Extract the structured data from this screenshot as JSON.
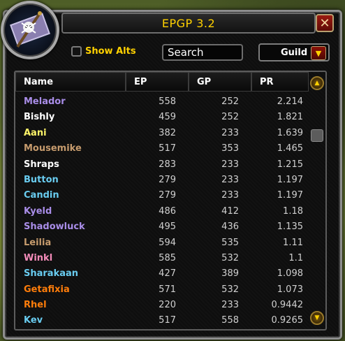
{
  "window": {
    "title": "EPGP 3.2",
    "close_glyph": "✕"
  },
  "toolbar": {
    "show_alts_label": "Show Alts",
    "search_label": "Search",
    "filter_value": "Guild",
    "filter_arrow_icon": "arrow-down-icon"
  },
  "columns": {
    "name": "Name",
    "ep": "EP",
    "gp": "GP",
    "pr": "PR"
  },
  "rows": [
    {
      "name": "Melador",
      "ep": "558",
      "gp": "252",
      "pr": "2.214",
      "color": "#a98de8"
    },
    {
      "name": "Bishly",
      "ep": "459",
      "gp": "252",
      "pr": "1.821",
      "color": "#ffffff"
    },
    {
      "name": "Aani",
      "ep": "382",
      "gp": "233",
      "pr": "1.639",
      "color": "#fff569"
    },
    {
      "name": "Mousemike",
      "ep": "517",
      "gp": "353",
      "pr": "1.465",
      "color": "#c69b6d"
    },
    {
      "name": "Shraps",
      "ep": "283",
      "gp": "233",
      "pr": "1.215",
      "color": "#ffffff"
    },
    {
      "name": "Button",
      "ep": "279",
      "gp": "233",
      "pr": "1.197",
      "color": "#69ccf0"
    },
    {
      "name": "Candin",
      "ep": "279",
      "gp": "233",
      "pr": "1.197",
      "color": "#69ccf0"
    },
    {
      "name": "Kyeld",
      "ep": "486",
      "gp": "412",
      "pr": "1.18",
      "color": "#a98de8"
    },
    {
      "name": "Shadowluck",
      "ep": "495",
      "gp": "436",
      "pr": "1.135",
      "color": "#a98de8"
    },
    {
      "name": "Leilia",
      "ep": "594",
      "gp": "535",
      "pr": "1.11",
      "color": "#c69b6d"
    },
    {
      "name": "Winkl",
      "ep": "585",
      "gp": "532",
      "pr": "1.1",
      "color": "#f58cba"
    },
    {
      "name": "Sharakaan",
      "ep": "427",
      "gp": "389",
      "pr": "1.098",
      "color": "#69ccf0"
    },
    {
      "name": "Getafixia",
      "ep": "571",
      "gp": "532",
      "pr": "1.073",
      "color": "#ff7d0a"
    },
    {
      "name": "Rhel",
      "ep": "220",
      "gp": "233",
      "pr": "0.9442",
      "color": "#ff7d0a"
    },
    {
      "name": "Kev",
      "ep": "517",
      "gp": "558",
      "pr": "0.9265",
      "color": "#69ccf0"
    }
  ],
  "icons": {
    "portrait": "guild-flag-skull-icon",
    "scroll_up": "scroll-up-icon",
    "scroll_down": "scroll-down-icon"
  },
  "colors": {
    "title": "#ffd100",
    "accent_red": "#8a1208"
  }
}
